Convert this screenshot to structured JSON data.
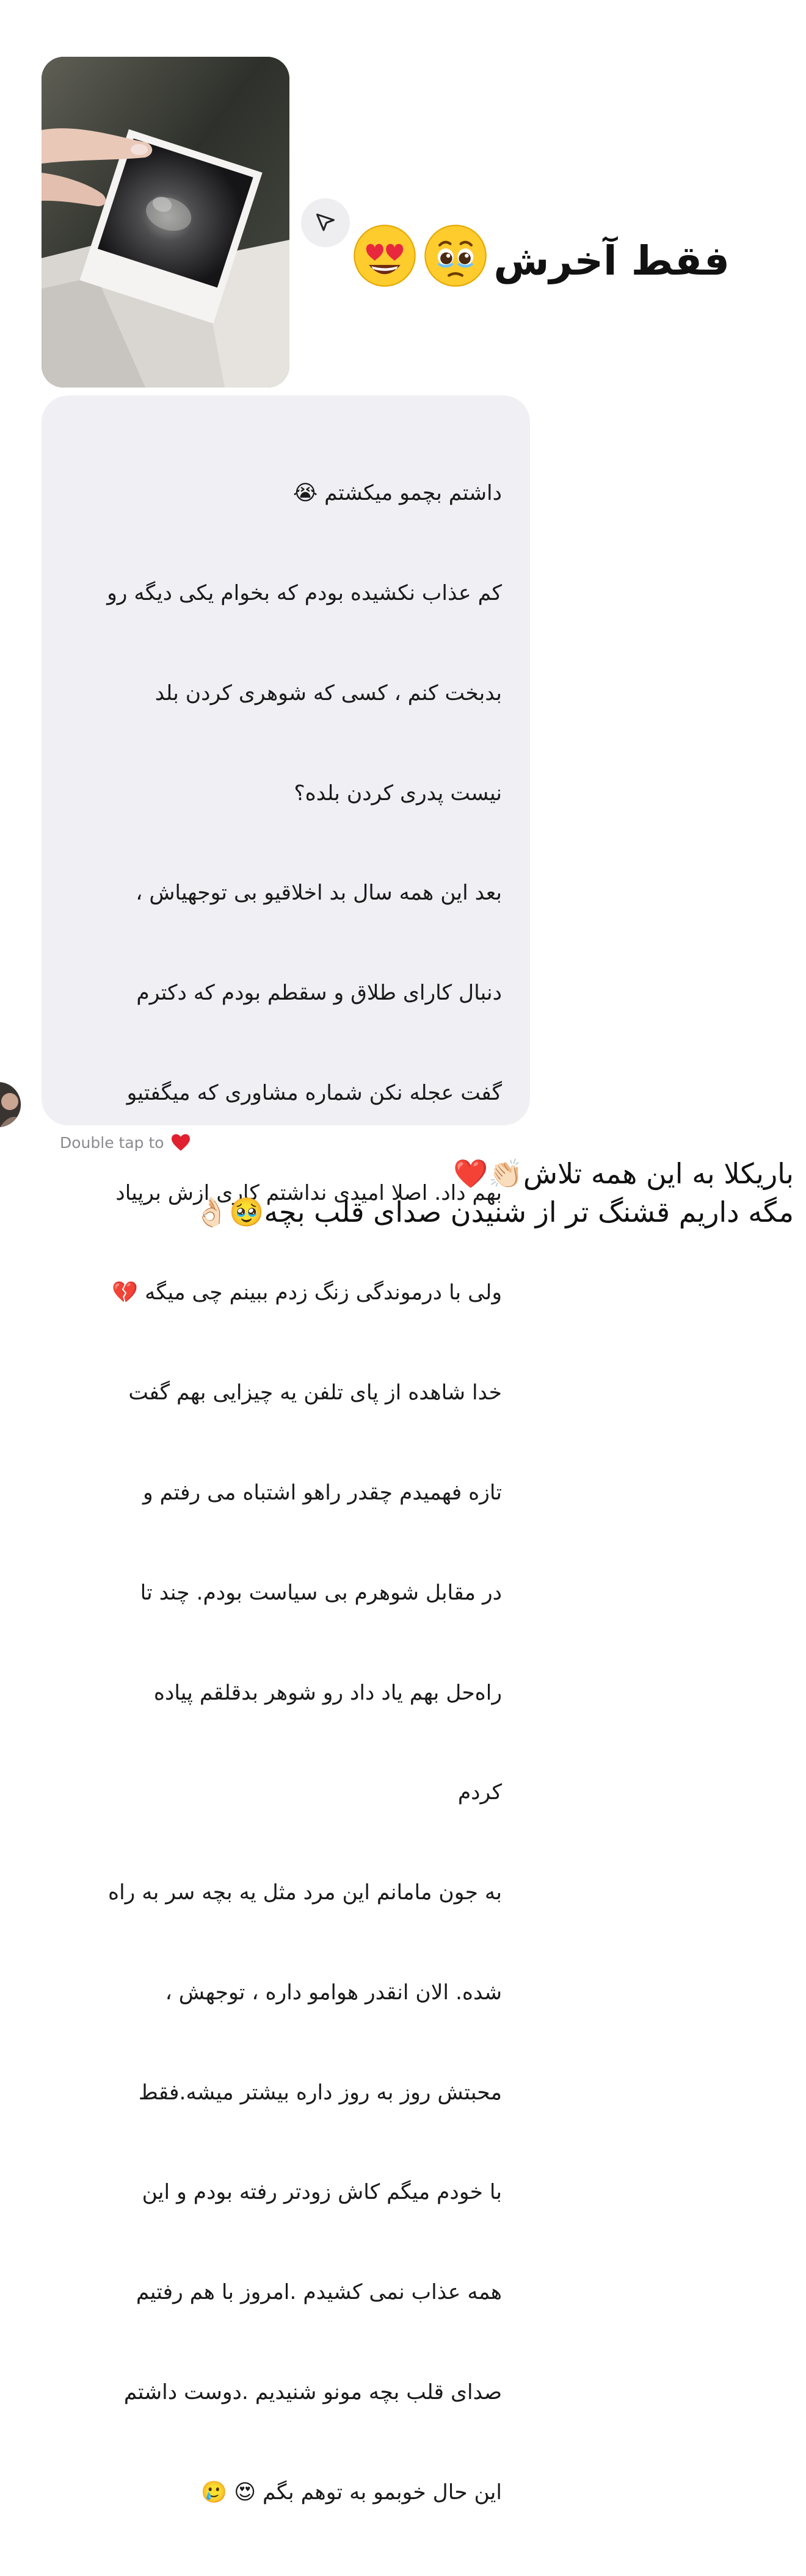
{
  "story_reply": {
    "headline": "فقط آخرش",
    "headline_emojis": [
      "face-holding-back-tears-emoji",
      "heart-eyes-emoji"
    ],
    "share_icon": "paper-plane-icon",
    "image_alt_icon": "ultrasound-photo"
  },
  "message": {
    "lines": [
      "داشتم بچمو میکشتم 😭",
      "کم عذاب نکشیده بودم که بخوام یکی دیگه رو",
      "بدبخت کنم ، کسی که شوهری کردن بلد",
      "نیست پدری کردن بلده؟",
      "بعد این همه سال بد اخلاقیو بی توجهیاش ،",
      "دنبال کارای طلاق و سقطم بودم که دکترم",
      "گفت عجله نکن شماره مشاوری که میگفتیو",
      "بهم داد. اصلا امیدی نداشتم کاری ازش برپیاد",
      "ولی با درموندگی زنگ زدم ببینم چی میگه 💔",
      "خدا شاهده از پای تلفن یه چیزایی بهم گفت",
      "تازه فهمیدم چقدر راهو اشتباه می رفتم و",
      "در مقابل شوهرم بی سیاست بودم. چند تا",
      "راه‌حل بهم یاد داد رو شوهر بدقلقم پیاده",
      "کردم",
      "به جون مامانم این مرد مثل یه بچه سر به راه",
      "شده. الان انقدر هوامو داره ، توجهش ،",
      "محبتش روز به روز داره بیشتر میشه.فقط",
      "با خودم میگم کاش زودتر رفته بودم و این",
      "همه عذاب نمی کشیدم .امروز با هم رفتیم",
      "صدای قلب بچه مونو شنیدیم .دوست داشتم",
      "این حال خوبمو به توهم بگم 😍 🥲"
    ]
  },
  "double_tap": {
    "label": "Double tap to",
    "icon": "heart-icon",
    "accent_color": "#e0202e"
  },
  "comment": {
    "line1": "باریکلا به این همه تلاش👏🏻❤️",
    "line2": "مگه داریم قشنگ تر از شنیدن صدای قلب بچه🥹👌🏻"
  },
  "colors": {
    "bubble_bg": "#efeff4",
    "text": "#111111",
    "muted": "#8a8a8f"
  }
}
